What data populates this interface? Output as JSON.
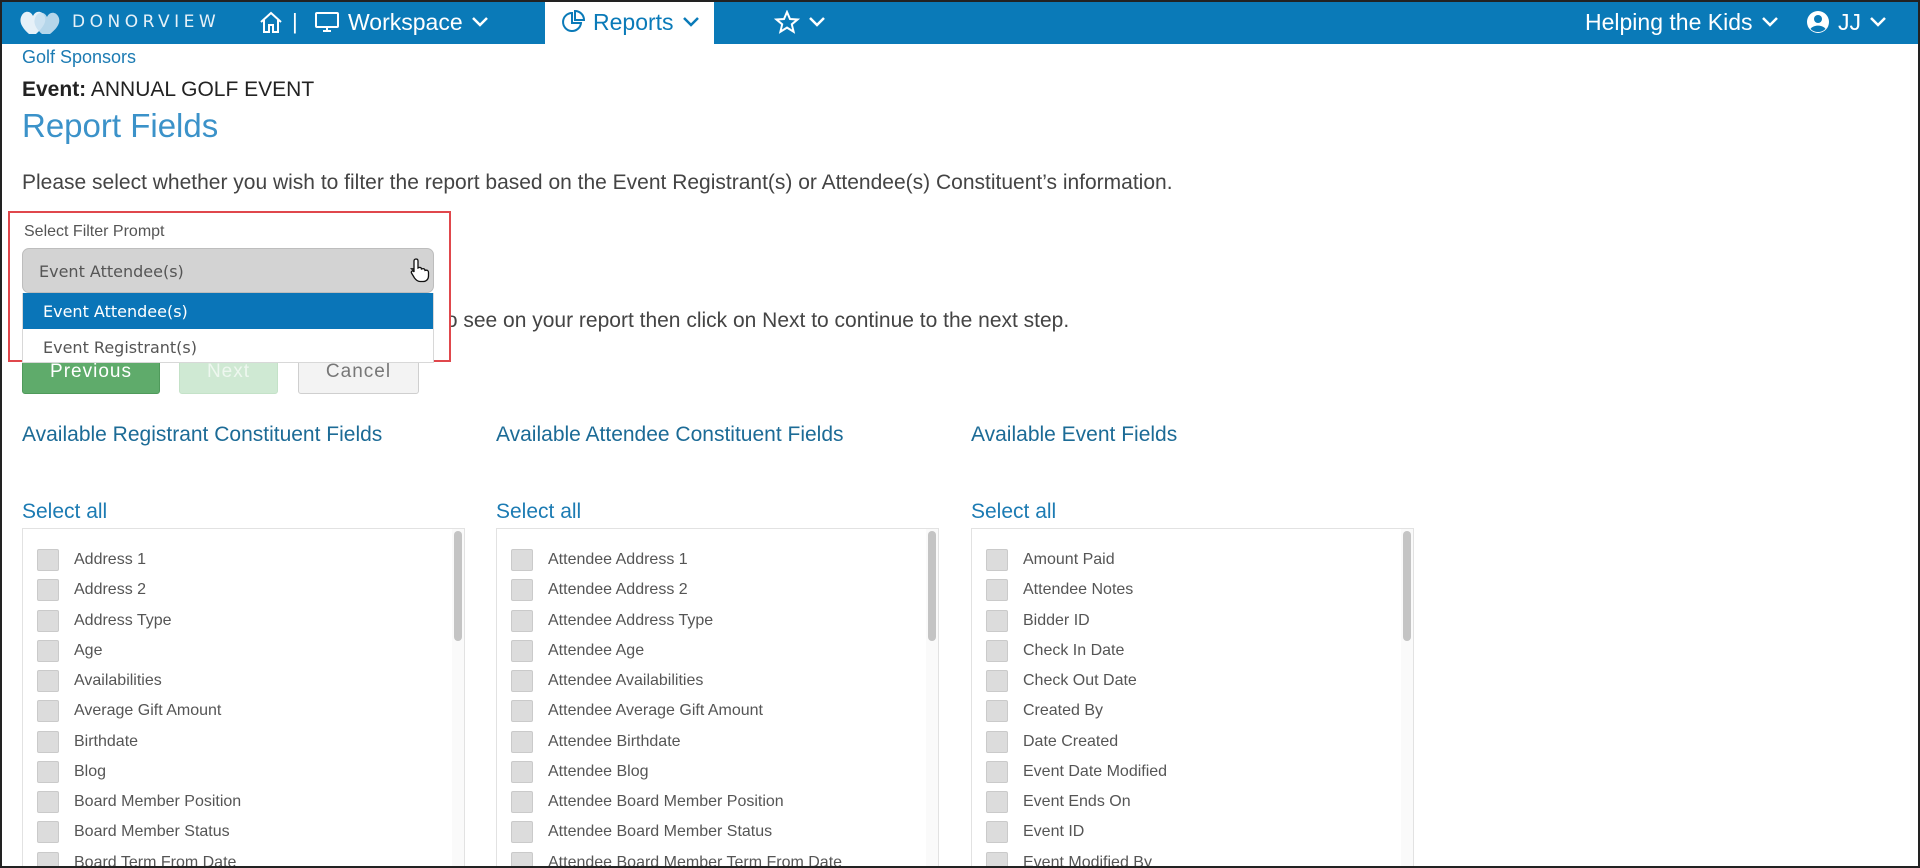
{
  "nav": {
    "brand": "DONORVIEW",
    "separator": "|",
    "workspace": "Workspace",
    "reports": "Reports",
    "org": "Helping the Kids",
    "user": "JJ",
    "icons": [
      "heart-logo-icon",
      "home-icon",
      "monitor-icon",
      "chevron-down-icon",
      "pie-chart-icon",
      "star-icon",
      "user-circle-icon"
    ]
  },
  "breadcrumb": "Golf Sponsors",
  "event": {
    "label": "Event:",
    "name": "ANNUAL GOLF EVENT"
  },
  "page_title": "Report Fields",
  "instructions": {
    "filter": "Please select whether you wish to filter the report based on the Event Registrant(s) or Attendee(s) Constituent’s information.",
    "fields_tail": "to see on your report then click on Next to continue to the next step."
  },
  "filter": {
    "label": "Select Filter Prompt",
    "selected": "Event Attendee(s)",
    "options": [
      "Event Attendee(s)",
      "Event Registrant(s)"
    ],
    "highlight_color": "#e0474c"
  },
  "buttons": {
    "previous": "Previous",
    "next": "Next",
    "cancel": "Cancel"
  },
  "select_all": "Select all",
  "columns": [
    {
      "title": "Available Registrant Constituent Fields",
      "fields": [
        "Address 1",
        "Address 2",
        "Address Type",
        "Age",
        "Availabilities",
        "Average Gift Amount",
        "Birthdate",
        "Blog",
        "Board Member Position",
        "Board Member Status",
        "Board Term From Date"
      ]
    },
    {
      "title": "Available Attendee Constituent Fields",
      "fields": [
        "Attendee Address 1",
        "Attendee Address 2",
        "Attendee Address Type",
        "Attendee Age",
        "Attendee Availabilities",
        "Attendee Average Gift Amount",
        "Attendee Birthdate",
        "Attendee Blog",
        "Attendee Board Member Position",
        "Attendee Board Member Status",
        "Attendee Board Member Term From Date"
      ]
    },
    {
      "title": "Available Event Fields",
      "fields": [
        "Amount Paid",
        "Attendee Notes",
        "Bidder ID",
        "Check In Date",
        "Check Out Date",
        "Created By",
        "Date Created",
        "Event Date Modified",
        "Event Ends On",
        "Event ID",
        "Event Modified By"
      ]
    }
  ],
  "colors": {
    "nav_bg": "#0a7ab8",
    "link": "#1c7bb3",
    "primary_button": "#5fab6b",
    "dropdown_selected": "#0a75b8"
  }
}
